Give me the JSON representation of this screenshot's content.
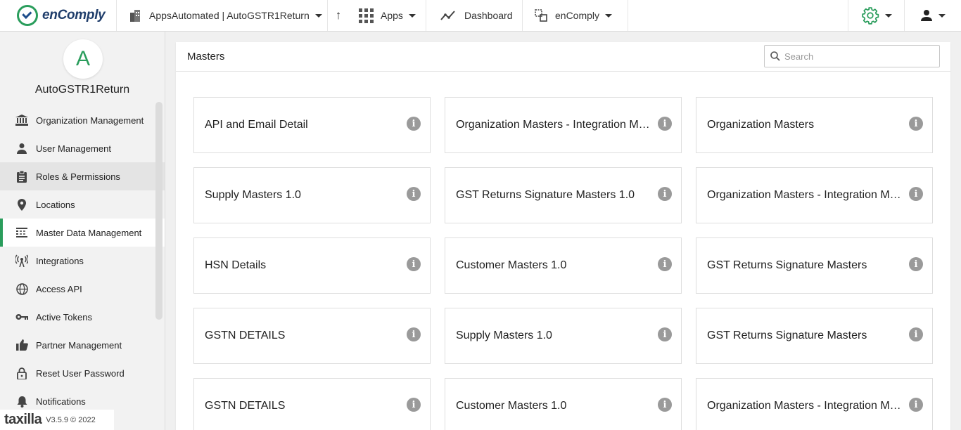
{
  "header": {
    "logo_text": "enComply",
    "org_selector": "AppsAutomated | AutoGSTR1Return",
    "up_arrow": "↑",
    "apps_label": "Apps",
    "dashboard_label": "Dashboard",
    "product_label": "enComply"
  },
  "sidebar": {
    "avatar_letter": "A",
    "org_name": "AutoGSTR1Return",
    "items": [
      {
        "label": "Organization Management",
        "icon": "bank-icon"
      },
      {
        "label": "User Management",
        "icon": "person-icon"
      },
      {
        "label": "Roles & Permissions",
        "icon": "clipboard-icon"
      },
      {
        "label": "Locations",
        "icon": "location-pin-icon"
      },
      {
        "label": "Master Data Management",
        "icon": "table-icon"
      },
      {
        "label": "Integrations",
        "icon": "antenna-icon"
      },
      {
        "label": "Access API",
        "icon": "globe-icon"
      },
      {
        "label": "Active Tokens",
        "icon": "key-icon"
      },
      {
        "label": "Partner Management",
        "icon": "thumbs-up-icon"
      },
      {
        "label": "Reset User Password",
        "icon": "lock-icon"
      },
      {
        "label": "Notifications",
        "icon": "bell-icon"
      }
    ],
    "footer_brand": "taxilla",
    "footer_version": "V3.5.9 © 2022"
  },
  "main": {
    "title": "Masters",
    "search_placeholder": "Search",
    "cards": [
      "API and Email Detail",
      "Organization Masters - Integration Masters",
      "Organization Masters",
      "Supply Masters 1.0",
      "GST Returns Signature Masters 1.0",
      "Organization Masters - Integration Masters",
      "HSN Details",
      "Customer Masters 1.0",
      "GST Returns Signature Masters",
      "GSTN DETAILS",
      "Supply Masters 1.0",
      "GST Returns Signature Masters",
      "GSTN DETAILS",
      "Customer Masters 1.0",
      "Organization Masters - Integration Masters"
    ],
    "info_glyph": "i"
  },
  "colors": {
    "accent": "#2a9d5c",
    "brand_dark": "#1f3d6b"
  }
}
